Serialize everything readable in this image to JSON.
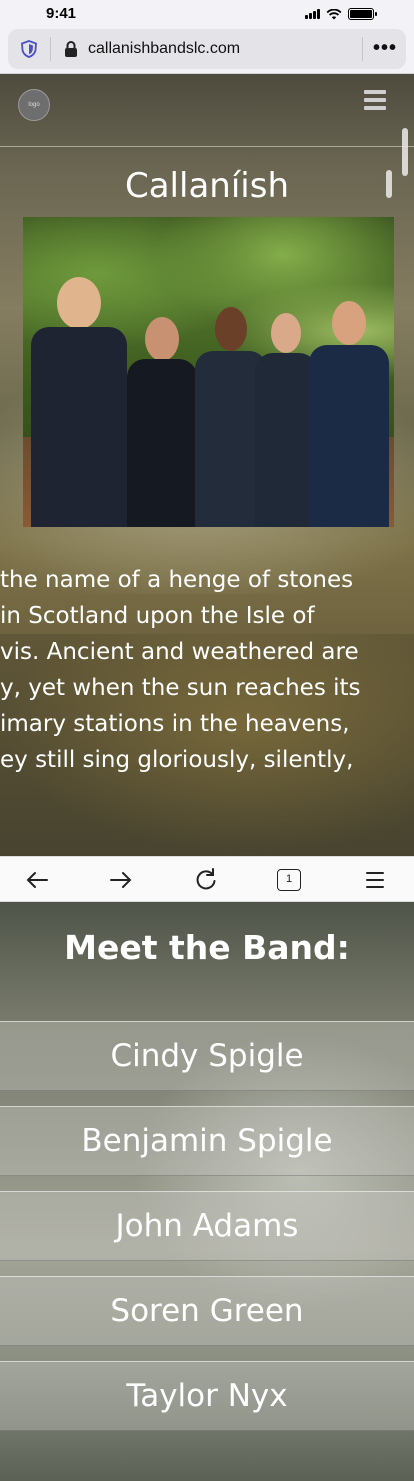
{
  "status_bar": {
    "time": "9:41"
  },
  "url_bar": {
    "url": "callanishbandslc.com",
    "more_label": "•••"
  },
  "header": {
    "logo_text": "logo",
    "title": "Callaníish"
  },
  "hero": {
    "lines": [
      " the name of a henge of stones",
      " in Scotland upon the Isle of",
      "vis. Ancient and weathered are",
      "y, yet when the sun reaches its",
      "imary stations in the heavens,",
      "ey still sing gloriously, silently,"
    ]
  },
  "toolbar": {
    "tab_count": "1"
  },
  "band": {
    "heading": "Meet the Band:",
    "members": [
      "Cindy Spigle",
      "Benjamin Spigle",
      "John Adams",
      "Soren Green",
      "Taylor Nyx"
    ]
  }
}
